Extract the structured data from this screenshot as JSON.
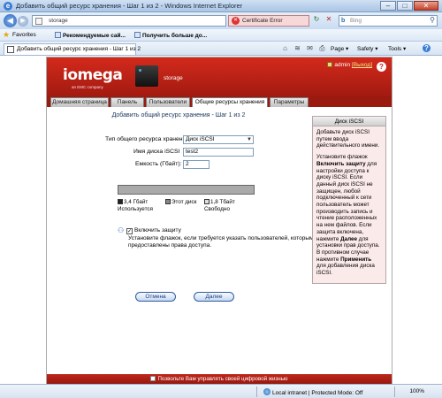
{
  "window": {
    "title": "Добавить общий ресурс хранения - Шаг 1 из 2 - Windows Internet Explorer",
    "controls": {
      "minimize": "–",
      "maximize": "□",
      "close": "✕"
    }
  },
  "address_bar": {
    "url": "storage",
    "cert_error": "Certificate Error",
    "search_placeholder": "Bing",
    "back": "◀",
    "forward": "▶",
    "refresh": "↻",
    "stop": "✕",
    "search_btn": "⚲"
  },
  "favorites_bar": {
    "favorites": "Favorites",
    "items": [
      "Рекомендуемые сай...",
      "Получить больше до..."
    ]
  },
  "browser_tab": {
    "label": "Добавить общий ресурс хранения - Шаг 1 из 2"
  },
  "command_bar": {
    "page": "Page ▾",
    "safety": "Safety ▾",
    "tools": "Tools ▾",
    "help": "?"
  },
  "app": {
    "logo_text": "iomega",
    "logo_sub": "an EMC company",
    "device_label": "storage",
    "user": "admin",
    "logout": "[Выход]",
    "help": "?",
    "tabs": [
      "Домашняя страница",
      "Панель",
      "Пользователи",
      "Общие ресурсы хранения",
      "Параметры"
    ],
    "active_tab_index": 3,
    "main": {
      "title": "Добавить общий ресурс хранения - Шаг 1 из 2",
      "type_label": "Тип общего ресурса хранения:",
      "type_value": "Диск iSCSI",
      "name_label": "Имя диска iSCSI",
      "name_value": "test2",
      "capacity_label": "Емкость (Гбайт):",
      "capacity_value": "2",
      "used_fraction": 0.0,
      "legend": {
        "used": {
          "value": "3,4 Гбайт",
          "label": "Используется"
        },
        "this_disk": {
          "label": "Этот диск"
        },
        "free": {
          "value": "1,8 Тбайт",
          "label": "Свободно"
        }
      },
      "protect_label": "Включить защиту",
      "protect_desc": "Установите флажок, если требуется указать пользователей, которым предоставлены права доступа.",
      "cancel": "Отмена",
      "next": "Далее"
    },
    "sidebar": {
      "title": "Диск iSCSI",
      "p1": "Добавьте диск iSCSI путем ввода действительного имени.",
      "p2_pre": "Установите флажок ",
      "p2_bold": "Включить защиту",
      "p2_post": " для настройки доступа к диску iSCSI. Если данный диск iSCSI не защищен, любой подключенный к сети пользователь может производить запись и чтение расположенных на нем файлов. Если защита включена, нажмите ",
      "p2_bold2": "Далее",
      "p2_post2": " для установки прав доступа. В противном случае нажмите ",
      "p2_bold3": "Применить",
      "p2_post3": " для добавления диска iSCSI."
    },
    "footer": "Позвольте Вам управлять своей цифровой жизнью"
  },
  "status_bar": {
    "zone": "Local intranet | Protected Mode: Off",
    "zoom": "100%"
  },
  "colors": {
    "header_red": "#c0261a",
    "used": "#222222",
    "this_disk": "#888888",
    "free": "#dddddd"
  }
}
